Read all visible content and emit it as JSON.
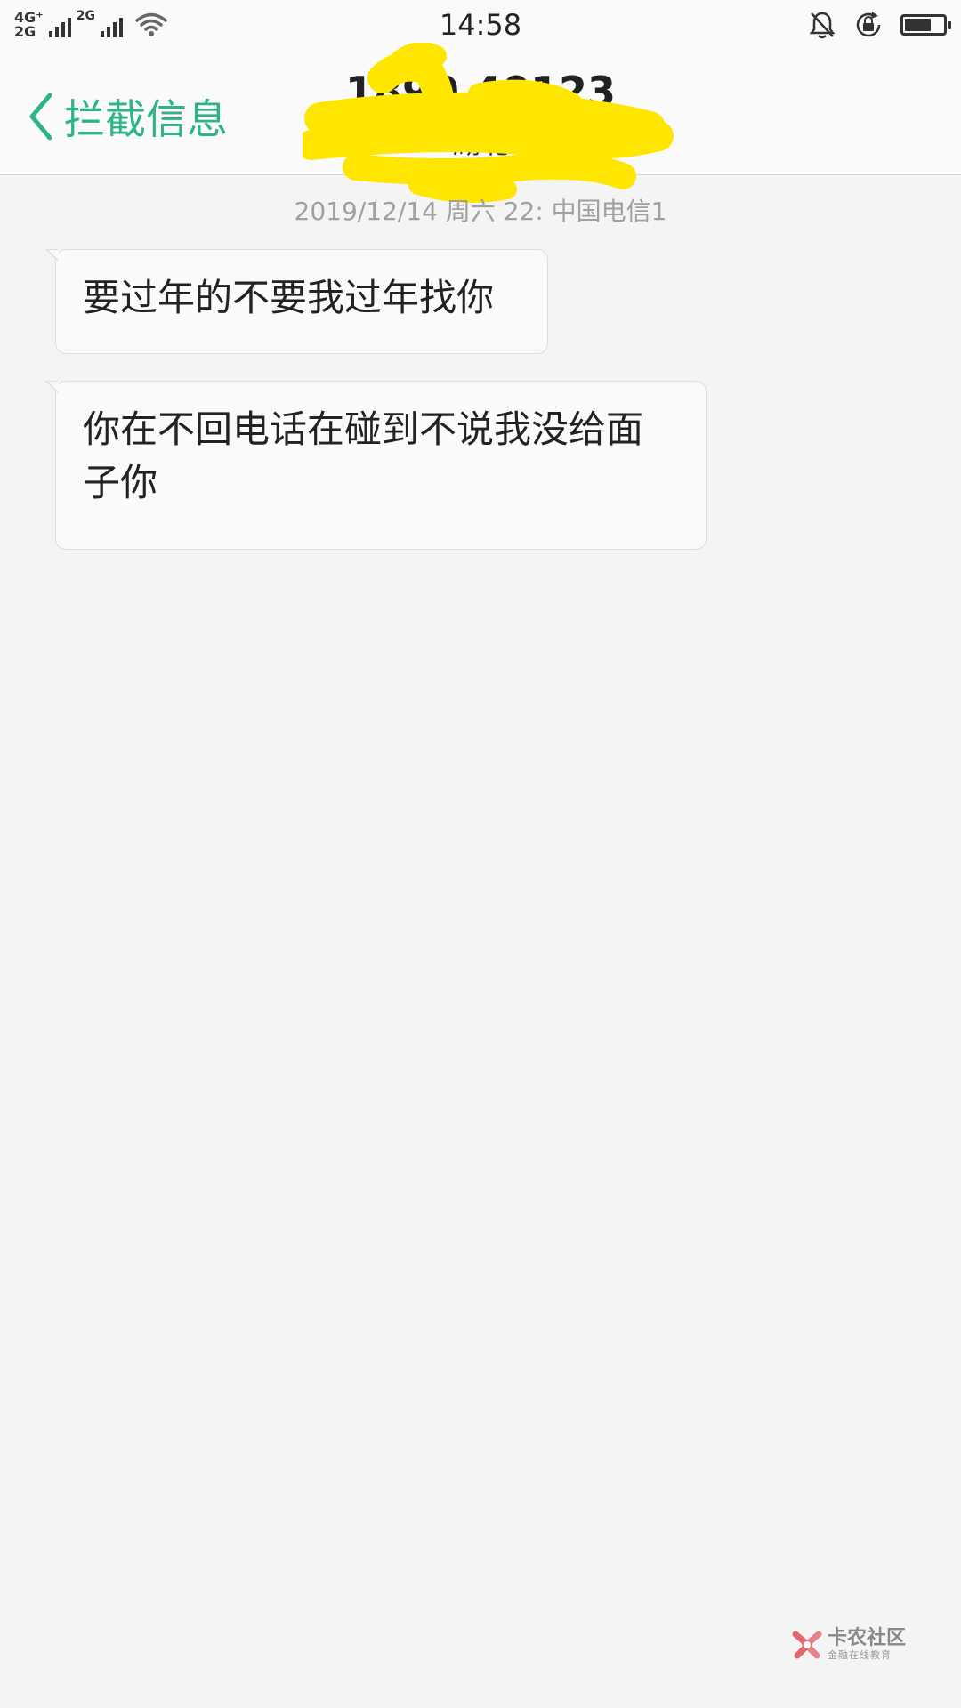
{
  "status_bar": {
    "network_top": "4G⁺",
    "network_bottom": "2G",
    "network_secondary": "2G",
    "time": "14:58",
    "battery_level": 0.62,
    "icons": [
      "signal-icon",
      "wifi-icon",
      "mute-bell-icon",
      "rotation-lock-icon",
      "battery-icon"
    ]
  },
  "header": {
    "back_label": "拦截信息",
    "contact_number": "1890  40123",
    "contact_location": "湖北",
    "accent_color": "#2fb38a"
  },
  "messages": {
    "timestamp": "2019/12/14 周六 22:  中国电信1",
    "items": [
      {
        "text": "要过年的不要我过年找你",
        "direction": "incoming"
      },
      {
        "text": "你在不回电话在碰到不说我没给面子你",
        "direction": "incoming"
      }
    ]
  },
  "watermark": {
    "title": "卡农社区",
    "subtitle": "金融在线教育"
  }
}
